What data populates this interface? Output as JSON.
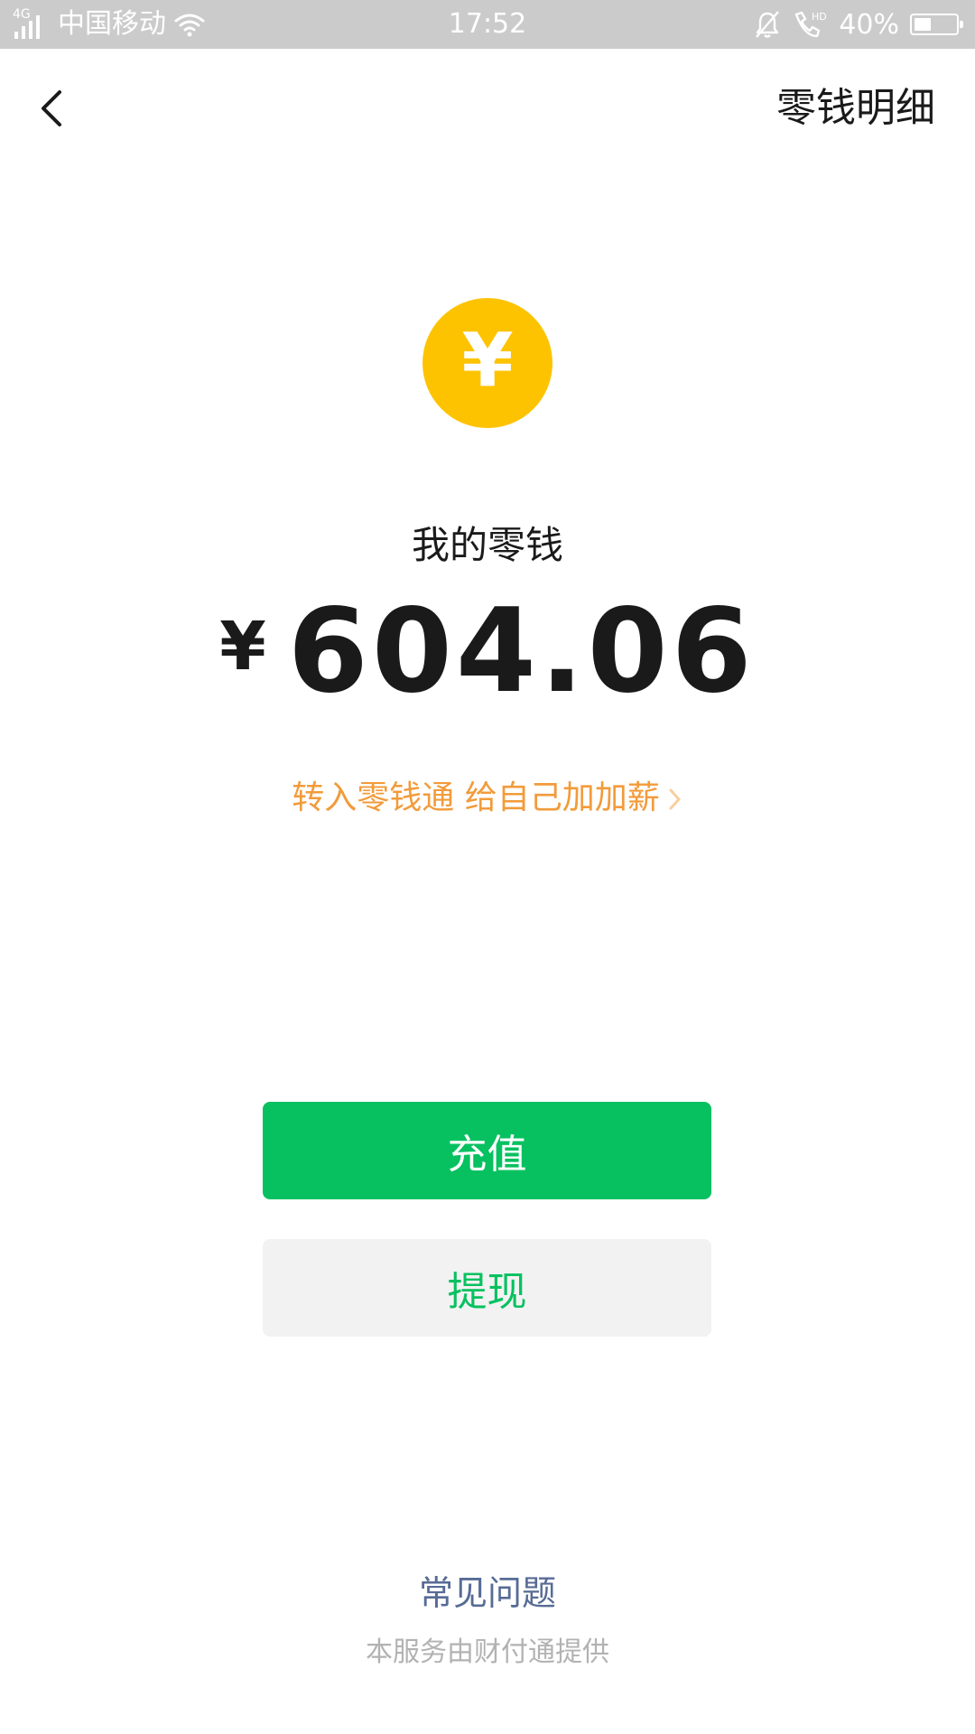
{
  "status_bar": {
    "network": "4G",
    "carrier": "中国移动",
    "time": "17:52",
    "battery": "40%",
    "battery_level": 0.4,
    "icons": [
      "signal-icon",
      "wifi-icon",
      "mute-bell-icon",
      "hd-call-icon",
      "battery-icon"
    ]
  },
  "header": {
    "back_icon": "chevron-left-icon",
    "detail_link": "零钱明细"
  },
  "wallet": {
    "coin_symbol": "¥",
    "label": "我的零钱",
    "currency": "¥",
    "amount": "604.06"
  },
  "promo": {
    "text": "转入零钱通 给自己加加薪",
    "icon": "chevron-right-icon"
  },
  "actions": {
    "recharge": "充值",
    "withdraw": "提现"
  },
  "footer": {
    "faq": "常见问题",
    "provider": "本服务由财付通提供"
  },
  "colors": {
    "status_bar": "#cbcbcb",
    "accent_green": "#07c160",
    "coin_yellow": "#fdc300",
    "promo_orange": "#f29b3a",
    "link_blue": "#576b95",
    "muted_text": "#b2b2b2"
  }
}
